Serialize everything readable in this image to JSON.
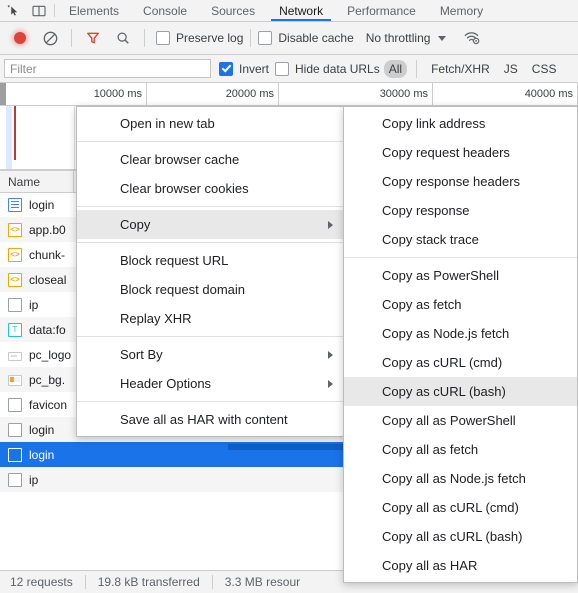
{
  "tabstrip": {
    "inspect_icon": "inspect-element-icon",
    "device_icon": "device-toolbar-icon",
    "tabs": [
      {
        "label": "Elements",
        "active": false
      },
      {
        "label": "Console",
        "active": false
      },
      {
        "label": "Sources",
        "active": false
      },
      {
        "label": "Network",
        "active": true
      },
      {
        "label": "Performance",
        "active": false
      },
      {
        "label": "Memory",
        "active": false
      }
    ]
  },
  "toolbar": {
    "record_title": "record-button",
    "clear_title": "clear-button",
    "filter_title": "filter-toggle",
    "search_title": "search-button",
    "preserve_log": {
      "label": "Preserve log",
      "checked": false
    },
    "disable_cache": {
      "label": "Disable cache",
      "checked": false
    },
    "throttling": "No throttling",
    "network_conditions_title": "network-conditions-icon"
  },
  "filterbar": {
    "placeholder": "Filter",
    "value": "",
    "invert": {
      "label": "Invert",
      "checked": true
    },
    "hide_data_urls": {
      "label": "Hide data URLs",
      "checked": false
    },
    "types": [
      {
        "label": "All",
        "active": true
      },
      {
        "label": "Fetch/XHR",
        "active": false
      },
      {
        "label": "JS",
        "active": false
      },
      {
        "label": "CSS",
        "active": false
      }
    ]
  },
  "overview": {
    "ticks": [
      "10000 ms",
      "20000 ms",
      "30000 ms",
      "40000 ms"
    ]
  },
  "table": {
    "columns": [
      "Name"
    ],
    "rows": [
      {
        "name": "login",
        "icon": "document-icon",
        "type": "doc",
        "selected": false
      },
      {
        "name": "app.b0",
        "icon": "script-icon",
        "type": "js",
        "selected": false
      },
      {
        "name": "chunk-",
        "icon": "script-icon",
        "type": "js",
        "selected": false
      },
      {
        "name": "closeal",
        "icon": "script-icon",
        "type": "js",
        "selected": false
      },
      {
        "name": "ip",
        "icon": "generic-file-icon",
        "type": "plain",
        "selected": false
      },
      {
        "name": "data:fo",
        "icon": "font-icon",
        "type": "txt",
        "selected": false
      },
      {
        "name": "pc_logo",
        "icon": "image-icon",
        "type": "img-w",
        "selected": false
      },
      {
        "name": "pc_bg.",
        "icon": "image-icon",
        "type": "img-b",
        "selected": false
      },
      {
        "name": "favicon",
        "icon": "generic-file-icon",
        "type": "plain",
        "selected": false
      },
      {
        "name": "login",
        "icon": "generic-file-icon",
        "type": "plain",
        "selected": false
      },
      {
        "name": "login",
        "icon": "generic-file-icon",
        "type": "plain",
        "selected": true
      },
      {
        "name": "ip",
        "icon": "generic-file-icon",
        "type": "plain",
        "selected": false
      }
    ]
  },
  "statusbar": {
    "requests": "12 requests",
    "transferred": "19.8 kB transferred",
    "resources": "3.3 MB resour"
  },
  "context_menu": {
    "items": [
      {
        "label": "Open in new tab",
        "submenu": false,
        "highlighted": false
      },
      {
        "sep": true
      },
      {
        "label": "Clear browser cache",
        "submenu": false,
        "highlighted": false
      },
      {
        "label": "Clear browser cookies",
        "submenu": false,
        "highlighted": false
      },
      {
        "sep": true
      },
      {
        "label": "Copy",
        "submenu": true,
        "highlighted": true
      },
      {
        "sep": true
      },
      {
        "label": "Block request URL",
        "submenu": false,
        "highlighted": false
      },
      {
        "label": "Block request domain",
        "submenu": false,
        "highlighted": false
      },
      {
        "label": "Replay XHR",
        "submenu": false,
        "highlighted": false
      },
      {
        "sep": true
      },
      {
        "label": "Sort By",
        "submenu": true,
        "highlighted": false
      },
      {
        "label": "Header Options",
        "submenu": true,
        "highlighted": false
      },
      {
        "sep": true
      },
      {
        "label": "Save all as HAR with content",
        "submenu": false,
        "highlighted": false
      }
    ]
  },
  "copy_submenu": {
    "items": [
      {
        "label": "Copy link address",
        "highlighted": false
      },
      {
        "label": "Copy request headers",
        "highlighted": false
      },
      {
        "label": "Copy response headers",
        "highlighted": false
      },
      {
        "label": "Copy response",
        "highlighted": false
      },
      {
        "label": "Copy stack trace",
        "highlighted": false
      },
      {
        "sep": true
      },
      {
        "label": "Copy as PowerShell",
        "highlighted": false
      },
      {
        "label": "Copy as fetch",
        "highlighted": false
      },
      {
        "label": "Copy as Node.js fetch",
        "highlighted": false
      },
      {
        "label": "Copy as cURL (cmd)",
        "highlighted": false
      },
      {
        "label": "Copy as cURL (bash)",
        "highlighted": true
      },
      {
        "label": "Copy all as PowerShell",
        "highlighted": false
      },
      {
        "label": "Copy all as fetch",
        "highlighted": false
      },
      {
        "label": "Copy all as Node.js fetch",
        "highlighted": false
      },
      {
        "label": "Copy all as cURL (cmd)",
        "highlighted": false
      },
      {
        "label": "Copy all as cURL (bash)",
        "highlighted": false
      },
      {
        "label": "Copy all as HAR",
        "highlighted": false
      }
    ]
  },
  "colors": {
    "accent": "#1a73e8",
    "record": "#db4437",
    "filter": "#db4437",
    "toolbar_bg": "#f3f3f3",
    "selection": "#1a73e8"
  }
}
